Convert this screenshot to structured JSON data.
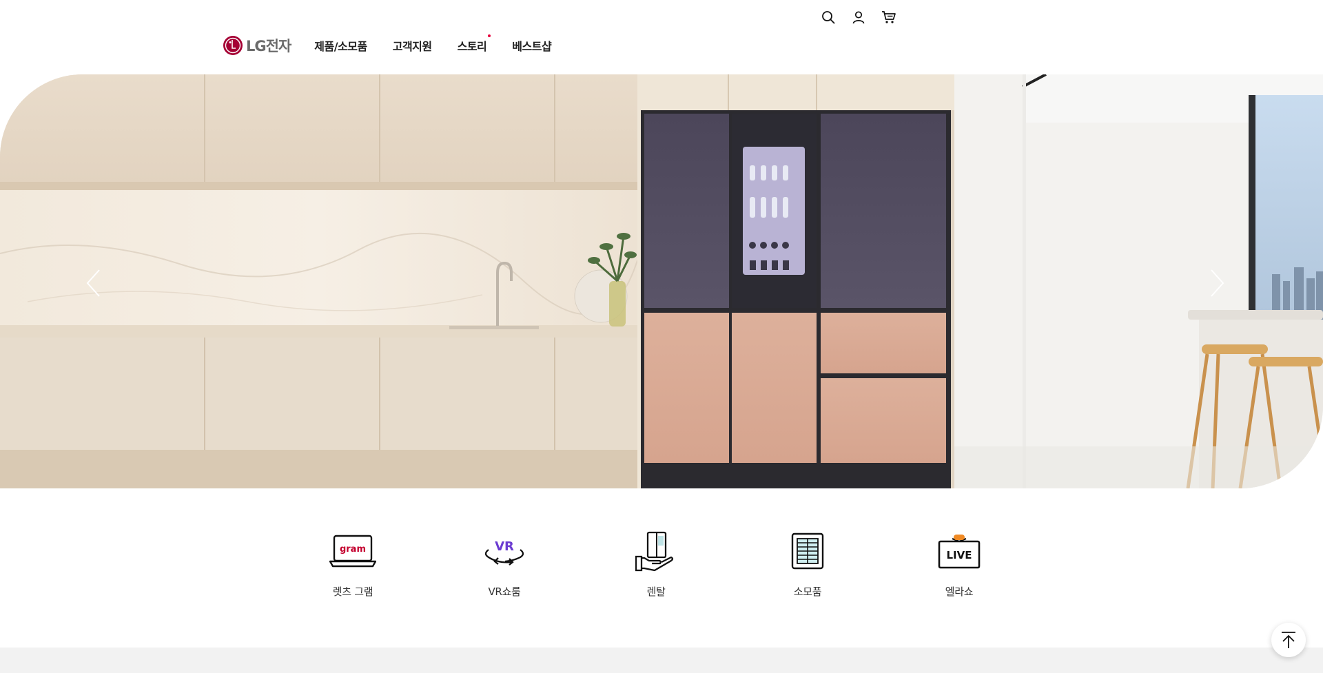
{
  "header": {
    "logo_text": "LG전자",
    "logo_letter": "L",
    "nav": [
      {
        "label": "제품/소모품",
        "has_dot": false
      },
      {
        "label": "고객지원",
        "has_dot": false
      },
      {
        "label": "스토리",
        "has_dot": true
      },
      {
        "label": "베스트샵",
        "has_dot": false
      }
    ],
    "utility_icons": [
      "search-icon",
      "user-icon",
      "cart-icon"
    ]
  },
  "hero": {
    "slide_description_colors": {
      "accent": "#a50034",
      "fridge_top": "#4f4a5c",
      "fridge_bottom": "#d9a892"
    }
  },
  "quick_menu": [
    {
      "label": "렛츠 그램",
      "icon": "gram-laptop-icon",
      "icon_text": "gram"
    },
    {
      "label": "VR쇼룸",
      "icon": "vr-icon",
      "icon_text": "VR"
    },
    {
      "label": "렌탈",
      "icon": "rental-fridge-hand-icon",
      "icon_text": ""
    },
    {
      "label": "소모품",
      "icon": "consumables-filter-icon",
      "icon_text": ""
    },
    {
      "label": "엘라쇼",
      "icon": "live-tv-icon",
      "icon_text": "LIVE"
    }
  ],
  "colors": {
    "brand": "#a50034",
    "nav_dot": "#e6003c",
    "vr_purple": "#6b3bd1",
    "footer_band": "#f2f2f2"
  }
}
